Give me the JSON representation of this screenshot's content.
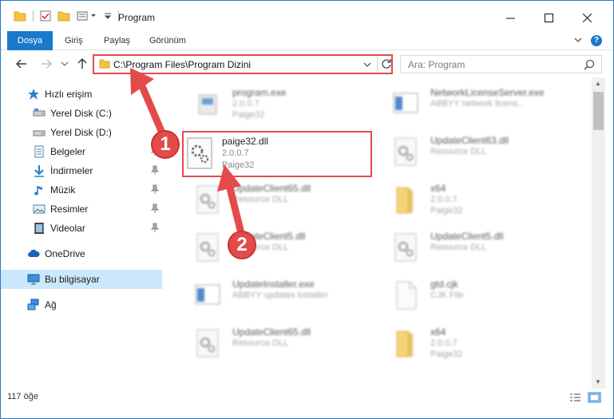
{
  "window": {
    "title": "Program",
    "controls": {
      "minimize": "─",
      "maximize": "☐",
      "close": "✕"
    }
  },
  "ribbon": {
    "tabs": [
      "Dosya",
      "Giriş",
      "Paylaş",
      "Görünüm"
    ],
    "help": "?"
  },
  "address_bar": {
    "path": "C:\\Program Files\\Program Dizini"
  },
  "search": {
    "placeholder": "Ara: Program"
  },
  "sidebar": {
    "items": [
      {
        "label": "Hızlı erişim",
        "icon": "star-icon"
      },
      {
        "label": "Yerel Disk (C:)",
        "icon": "drive-icon"
      },
      {
        "label": "Yerel Disk (D:)",
        "icon": "drive-icon"
      },
      {
        "label": "Belgeler",
        "icon": "documents-icon",
        "pinned": true
      },
      {
        "label": "İndirmeler",
        "icon": "downloads-icon",
        "pinned": true
      },
      {
        "label": "Müzik",
        "icon": "music-icon",
        "pinned": true
      },
      {
        "label": "Resimler",
        "icon": "pictures-icon",
        "pinned": true
      },
      {
        "label": "Videolar",
        "icon": "videos-icon",
        "pinned": true
      },
      {
        "label": "OneDrive",
        "icon": "cloud-icon"
      },
      {
        "label": "Bu bilgisayar",
        "icon": "computer-icon",
        "selected": true
      },
      {
        "label": "Ağ",
        "icon": "network-icon"
      }
    ]
  },
  "files": [
    {
      "name": "program.exe",
      "line2": "2.0.0.7",
      "line3": "Paige32",
      "icon": "exe-icon"
    },
    {
      "name": "NetworkLicenseServer.exe",
      "line2": "ABBYY network licens...",
      "line3": "",
      "icon": "app-window-icon"
    },
    {
      "name": "paige32.dll",
      "line2": "2.0.0.7",
      "line3": "Paige32",
      "icon": "dll-gear-icon",
      "highlighted": true
    },
    {
      "name": "UpdateClient63.dll",
      "line2": "Resource DLL",
      "line3": "",
      "icon": "dll-gear-icon"
    },
    {
      "name": "UpdateClient65.dll",
      "line2": "Resource DLL",
      "line3": "",
      "icon": "dll-gear-icon"
    },
    {
      "name": "x64",
      "line2": "2.0.0.7",
      "line3": "Paige32",
      "icon": "folder-icon"
    },
    {
      "name": "UpdateClient5.dll",
      "line2": "Resource DLL",
      "line3": "",
      "icon": "dll-gear-icon"
    },
    {
      "name": "UpdateClient5.dll",
      "line2": "Resource DLL",
      "line3": "",
      "icon": "dll-gear-icon"
    },
    {
      "name": "UpdateInstaller.exe",
      "line2": "ABBYY updates installer",
      "line3": "",
      "icon": "app-window-icon"
    },
    {
      "name": "gtd.cjk",
      "line2": "CJK File",
      "line3": "",
      "icon": "file-icon"
    },
    {
      "name": "UpdateClient65.dll",
      "line2": "Resource DLL",
      "line3": "",
      "icon": "dll-gear-icon"
    },
    {
      "name": "x64",
      "line2": "2.0.0.7",
      "line3": "Paige32",
      "icon": "folder-icon"
    }
  ],
  "status": {
    "item_count": "117 öğe"
  },
  "annotations": {
    "step1": "1",
    "step2": "2"
  },
  "colors": {
    "accent": "#1979ca",
    "highlight": "#e34b4b",
    "selected": "#cce8ff"
  }
}
